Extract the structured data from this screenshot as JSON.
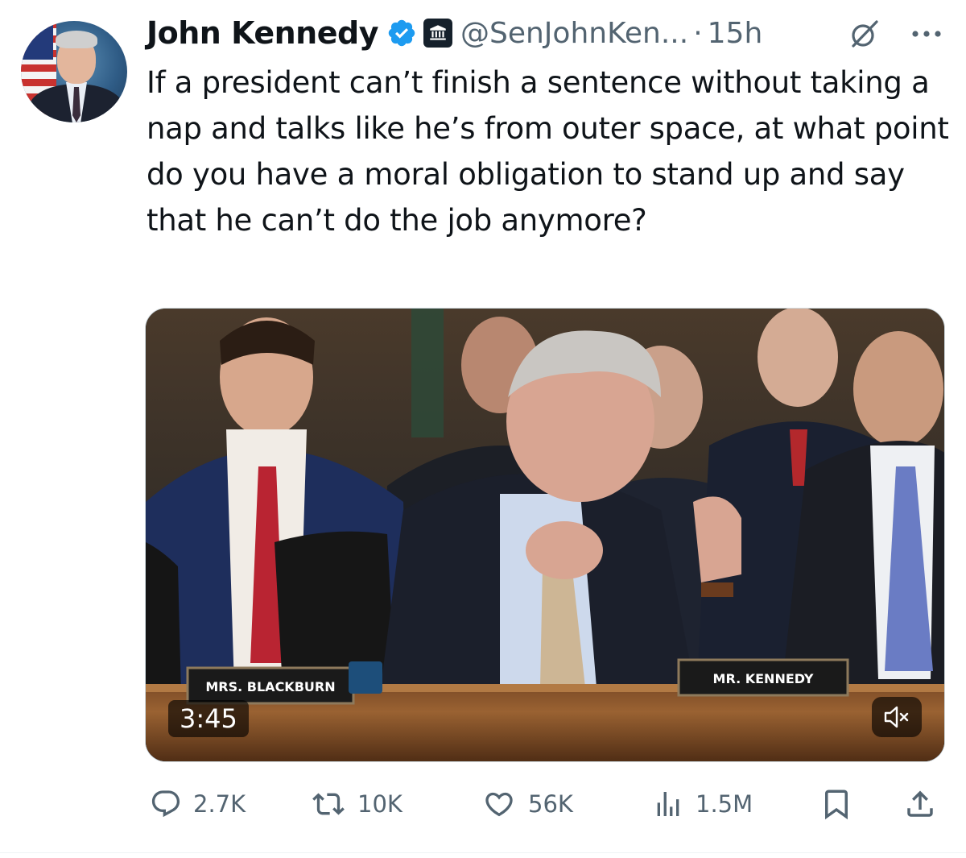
{
  "author": {
    "name": "John Kennedy",
    "handle": "@SenJohnKen...",
    "separator": "·",
    "time": "15h",
    "verified_icon": "verified-badge-icon",
    "affiliation_icon": "government-building-icon"
  },
  "tweet": {
    "text": "If a president can’t finish a sentence without taking a nap and talks like he’s from outer space, at what point do you have a moral obligation to stand up and say that he can’t do the job anymore?"
  },
  "media": {
    "type": "video",
    "duration": "3:45",
    "nameplate_left": "MRS. BLACKBURN",
    "nameplate_right": "MR. KENNEDY",
    "mute_icon": "speaker-muted-icon"
  },
  "actions": {
    "replies": "2.7K",
    "reposts": "10K",
    "likes": "56K",
    "views": "1.5M"
  },
  "colors": {
    "verified": "#1d9bf0",
    "muted_text": "#536471",
    "text": "#0f1419"
  }
}
